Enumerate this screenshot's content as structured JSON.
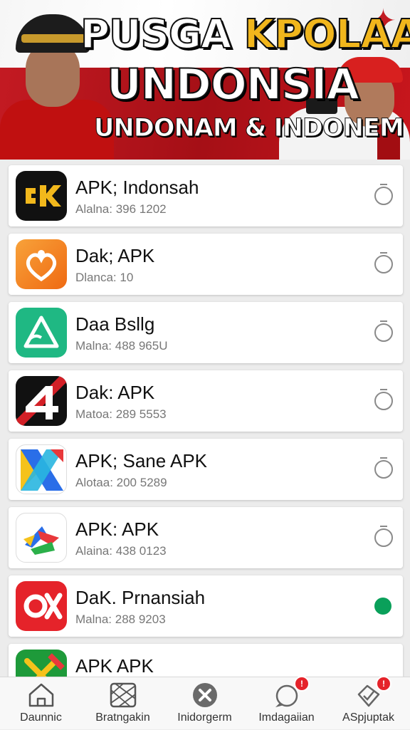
{
  "banner": {
    "title_part1": "PUSGA",
    "title_part2": "KPOLAA",
    "title_line2": "UNDONSIA",
    "subtitle": "UNDONAM & INDONEM",
    "colors": {
      "red": "#c8161d",
      "gold": "#f1b61c",
      "white": "#ffffff"
    }
  },
  "apps": [
    {
      "name": "APK; Indonsah",
      "meta": "Alalna: 396 1202",
      "icon": "play-k-logo-icon",
      "status": "ring"
    },
    {
      "name": "Dak; APK",
      "meta": "Dlanca: 10",
      "icon": "orange-heart-logo-icon",
      "status": "ring"
    },
    {
      "name": "Daa Bsllg",
      "meta": "Malna: 488 965U",
      "icon": "green-triangle-logo-icon",
      "status": "ring"
    },
    {
      "name": "Dak: APK",
      "meta": "Matoa: 289 5553",
      "icon": "number-4-logo-icon",
      "status": "ring"
    },
    {
      "name": "APK; Sane APK",
      "meta": "Alotaa: 200 5289",
      "icon": "blue-x-logo-icon",
      "status": "ring"
    },
    {
      "name": "APK: APK",
      "meta": "Alaina: 438 0123",
      "icon": "colorful-arrows-logo-icon",
      "status": "ring"
    },
    {
      "name": "DaK. Prnansiah",
      "meta": "Malna: 288 9203",
      "icon": "red-ox-logo-icon",
      "status": "dot"
    },
    {
      "name": "APK APK",
      "meta": "",
      "icon": "green-x-logo-icon",
      "status": "none"
    }
  ],
  "status_colors": {
    "ring": "#8a8a8a",
    "dot": "#0aa05a"
  },
  "nav": [
    {
      "label": "Daunnic",
      "icon": "home-icon",
      "badge": ""
    },
    {
      "label": "Bratngakin",
      "icon": "grid-image-icon",
      "badge": ""
    },
    {
      "label": "Inidorgerm",
      "icon": "close-circle-icon",
      "badge": ""
    },
    {
      "label": "Imdagaiian",
      "icon": "chat-bubble-icon",
      "badge": "!"
    },
    {
      "label": "ASpjuptak",
      "icon": "check-tag-icon",
      "badge": "!"
    }
  ]
}
